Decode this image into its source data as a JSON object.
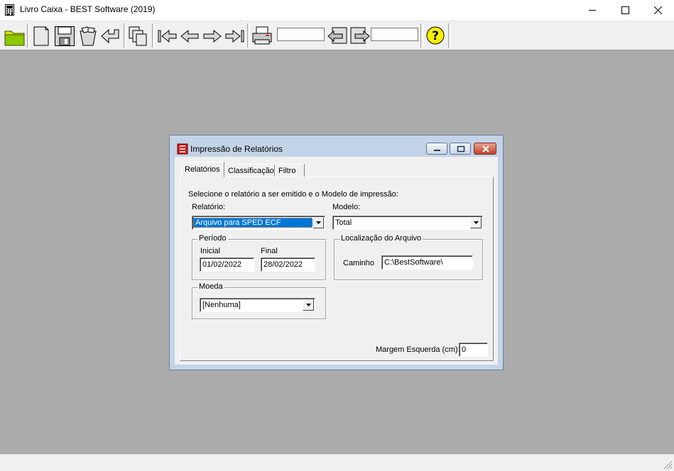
{
  "window": {
    "title": "Livro Caixa - BEST Software (2019)"
  },
  "toolbar": {
    "buttons": [
      "open-folder-icon",
      "new-page-icon",
      "save-disk-icon",
      "delete-bin-icon",
      "undo-icon",
      "copy-pages-icon",
      "first-record-icon",
      "previous-record-icon",
      "next-record-icon",
      "last-record-icon",
      "print-icon",
      "go-back-icon",
      "go-forward-icon",
      "help-icon"
    ],
    "search_value_1": "",
    "search_value_2": ""
  },
  "dialog": {
    "title": "Impressão de Relatórios",
    "tabs": [
      "Relatórios",
      "Classificação",
      "Filtro"
    ],
    "active_tab": "Relatórios",
    "instruction": "Selecione o relatório a ser emitido e o Modelo de impressão:",
    "relatorio_label": "Relatório:",
    "relatorio_value": "Arquivo para SPED ECF",
    "modelo_label": "Modelo:",
    "modelo_value": "Total",
    "periodo": {
      "caption": "Período",
      "inicial_label": "Inicial",
      "inicial_value": "01/02/2022",
      "final_label": "Final",
      "final_value": "28/02/2022"
    },
    "localizacao": {
      "caption": "Localização do Arquivo",
      "caminho_label": "Caminho",
      "caminho_value": "C:\\BestSoftware\\"
    },
    "moeda": {
      "caption": "Moeda",
      "value": "[Nenhuma]"
    },
    "margem_label": "Margem Esquerda (cm):",
    "margem_value": "0"
  },
  "colors": {
    "mdi_background": "#ababab",
    "selection": "#0078d7",
    "dialog_frame": "#c4d4e8"
  }
}
